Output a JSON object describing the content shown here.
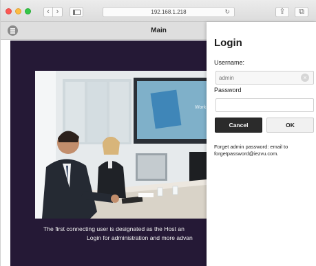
{
  "browser": {
    "address": "192.168.1.218",
    "back_glyph": "‹",
    "forward_glyph": "›",
    "reload_glyph": "↻",
    "share_glyph": "⇪",
    "tabs_glyph": "⧉"
  },
  "header": {
    "title": "Main"
  },
  "main": {
    "caption_line1": "The first connecting user is designated as the Host an",
    "caption_line2": "Login for administration and more advan",
    "screen_text": "Work",
    "background_color": "#251936"
  },
  "login": {
    "title": "Login",
    "username_label": "Username:",
    "username_placeholder": "admin",
    "password_label": "Password",
    "password_value": "",
    "clear_glyph": "×",
    "cancel_label": "Cancel",
    "ok_label": "OK",
    "forget_text": "Forget admin password: email to forgetpassword@iezvu.com."
  }
}
